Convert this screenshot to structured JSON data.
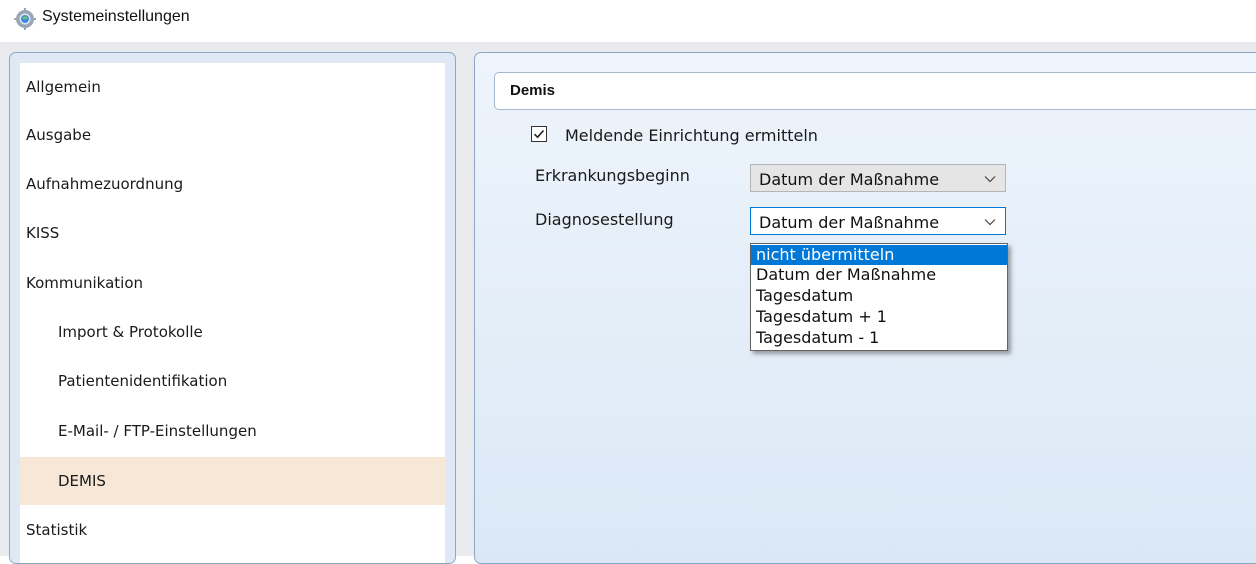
{
  "window": {
    "title": "Systemeinstellungen",
    "icon": "gear-globe-icon"
  },
  "sidebar": {
    "items": [
      {
        "label": "Allgemein",
        "level": 0
      },
      {
        "label": "Ausgabe",
        "level": 0
      },
      {
        "label": "Aufnahmezuordnung",
        "level": 0
      },
      {
        "label": "KISS",
        "level": 0
      },
      {
        "label": "Kommunikation",
        "level": 0
      },
      {
        "label": "Import & Protokolle",
        "level": 1
      },
      {
        "label": "Patientenidentifikation",
        "level": 1
      },
      {
        "label": "E-Mail- / FTP-Einstellungen",
        "level": 1
      },
      {
        "label": "DEMIS",
        "level": 1,
        "selected": true
      },
      {
        "label": "Statistik",
        "level": 0
      }
    ]
  },
  "main": {
    "section_title": "Demis",
    "checkbox": {
      "label": "Meldende Einrichtung ermitteln",
      "checked": true
    },
    "fields": [
      {
        "label": "Erkrankungsbeginn",
        "value": "Datum der Maßnahme"
      },
      {
        "label": "Diagnosestellung",
        "value": "Datum der Maßnahme",
        "open": true
      }
    ],
    "dropdown": {
      "options": [
        "nicht übermitteln",
        "Datum der Maßnahme",
        "Tagesdatum",
        "Tagesdatum + 1",
        "Tagesdatum - 1"
      ],
      "highlighted_index": 0
    }
  },
  "colors": {
    "accent": "#0078d7",
    "selected_item_bg": "#f6e7d6",
    "panel_border": "#8ea7c4"
  }
}
